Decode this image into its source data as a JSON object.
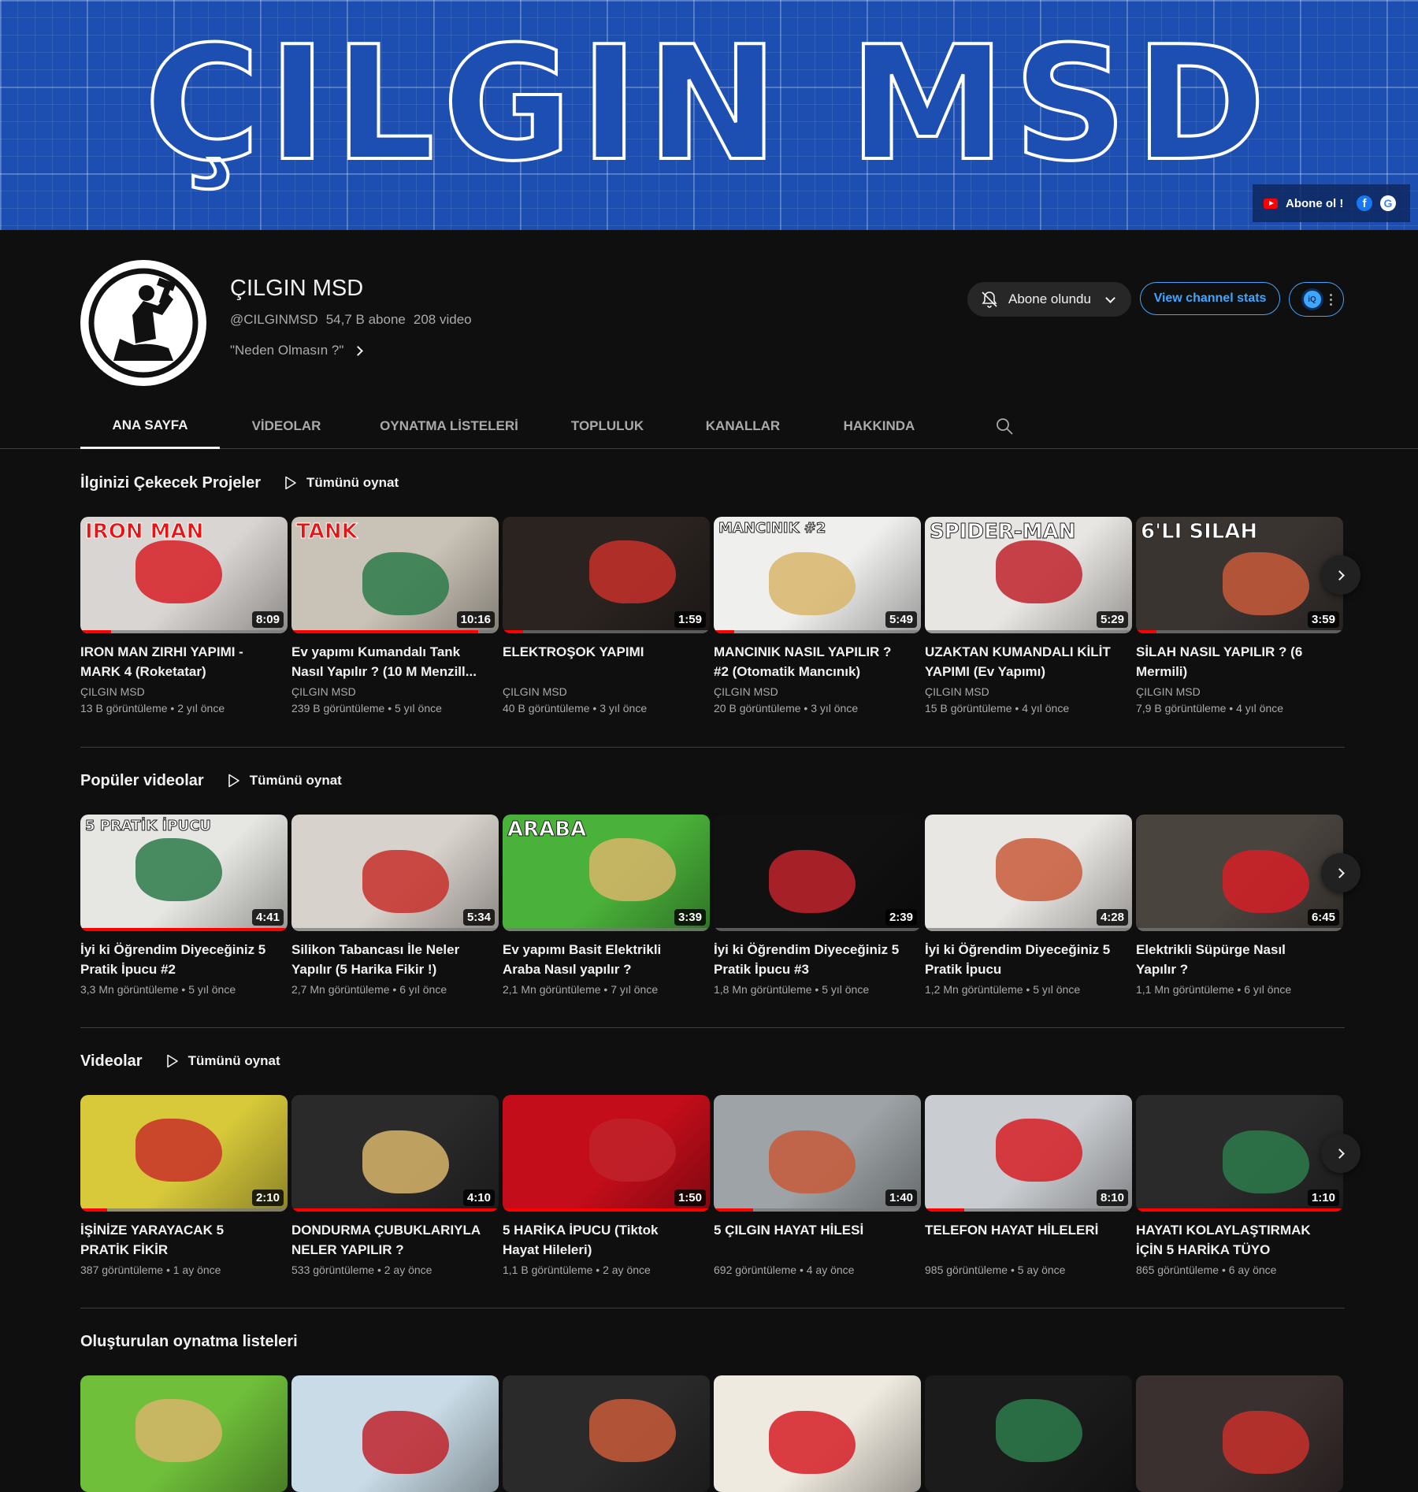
{
  "banner": {
    "title": "ÇILGIN MSD",
    "links": [
      {
        "label": "Abone ol !",
        "icon": "youtube-icon"
      },
      {
        "label": "",
        "icon": "facebook-icon"
      },
      {
        "label": "",
        "icon": "google-icon"
      }
    ]
  },
  "channel": {
    "name": "ÇILGIN MSD",
    "handle": "@CILGINMSD",
    "subscribers": "54,7 B abone",
    "video_count": "208 video",
    "description": "\"Neden Olmasın ?\"",
    "subscribed_label": "Abone olundu",
    "stats_label": "View channel stats",
    "ext_badge": "iQ"
  },
  "tabs": [
    {
      "label": "ANA SAYFA",
      "active": true
    },
    {
      "label": "VİDEOLAR",
      "active": false
    },
    {
      "label": "OYNATMA LİSTELERİ",
      "active": false
    },
    {
      "label": "TOPLULUK",
      "active": false
    },
    {
      "label": "KANALLAR",
      "active": false
    },
    {
      "label": "HAKKINDA",
      "active": false
    }
  ],
  "shelves": [
    {
      "title": "İlginizi Çekecek Projeler",
      "play_all": "Tümünü oynat",
      "videos": [
        {
          "title": "IRON MAN ZIRHI YAPIMI - MARK 4 (Roketatar)",
          "channel": "ÇILGIN MSD",
          "meta": "13 B görüntüleme • 2 yıl önce",
          "duration": "8:09",
          "tag": "IRON MAN",
          "progress": 0.15
        },
        {
          "title": "Ev yapımı Kumandalı Tank Nasıl Yapılır ? (10 M Menzill...",
          "channel": "ÇILGIN MSD",
          "meta": "239 B görüntüleme • 5 yıl önce",
          "duration": "10:16",
          "tag": "TANK",
          "progress": 0.9
        },
        {
          "title": "ELEKTROŞOK YAPIMI",
          "channel": "ÇILGIN MSD",
          "meta": "40 B görüntüleme • 3 yıl önce",
          "duration": "1:59",
          "tag": "",
          "progress": 0.1
        },
        {
          "title": "MANCINIK NASIL YAPILIR ? #2 (Otomatik Mancınık)",
          "channel": "ÇILGIN MSD",
          "meta": "20 B görüntüleme • 3 yıl önce",
          "duration": "5:49",
          "tag": "MANCINIK #2",
          "progress": 0.1
        },
        {
          "title": "UZAKTAN KUMANDALI KİLİT YAPIMI (Ev Yapımı)",
          "channel": "ÇILGIN MSD",
          "meta": "15 B görüntüleme • 4 yıl önce",
          "duration": "5:29",
          "tag": "SPIDER-MAN",
          "progress": 0.0
        },
        {
          "title": "SİLAH NASIL YAPILIR ? (6 Mermili)",
          "channel": "ÇILGIN MSD",
          "meta": "7,9 B görüntüleme • 4 yıl önce",
          "duration": "3:59",
          "tag": "6'LI SILAH",
          "progress": 0.1
        }
      ]
    },
    {
      "title": "Popüler videolar",
      "play_all": "Tümünü oynat",
      "videos": [
        {
          "title": "İyi ki Öğrendim Diyeceğiniz 5 Pratik İpucu #2",
          "channel": "",
          "meta": "3,3 Mn görüntüleme • 5 yıl önce",
          "duration": "4:41",
          "tag": "5 PRATİK İPUCU",
          "progress": 1.0
        },
        {
          "title": "Silikon Tabancası İle Neler Yapılır (5 Harika Fikir !)",
          "channel": "",
          "meta": "2,7 Mn görüntüleme • 6 yıl önce",
          "duration": "5:34",
          "tag": "",
          "progress": 0.0
        },
        {
          "title": "Ev yapımı Basit Elektrikli Araba Nasıl yapılır ?",
          "channel": "",
          "meta": "2,1 Mn görüntüleme • 7 yıl önce",
          "duration": "3:39",
          "tag": "ARABA",
          "progress": 0.0
        },
        {
          "title": "İyi ki Öğrendim Diyeceğiniz 5 Pratik İpucu #3",
          "channel": "",
          "meta": "1,8 Mn görüntüleme • 5 yıl önce",
          "duration": "2:39",
          "tag": "",
          "progress": 0.0
        },
        {
          "title": "İyi ki Öğrendim Diyeceğiniz 5 Pratik İpucu",
          "channel": "",
          "meta": "1,2 Mn görüntüleme • 5 yıl önce",
          "duration": "4:28",
          "tag": "",
          "progress": 0.0
        },
        {
          "title": "Elektrikli Süpürge Nasıl Yapılır ?",
          "channel": "",
          "meta": "1,1 Mn görüntüleme • 6 yıl önce",
          "duration": "6:45",
          "tag": "",
          "progress": 0.0
        }
      ]
    },
    {
      "title": "Videolar",
      "play_all": "Tümünü oynat",
      "videos": [
        {
          "title": "İŞİNİZE YARAYACAK 5 PRATİK FİKİR",
          "channel": "",
          "meta": "387 görüntüleme • 1 ay önce",
          "duration": "2:10",
          "tag": "",
          "progress": 0.13
        },
        {
          "title": "DONDURMA ÇUBUKLARIYLA NELER YAPILIR ?",
          "channel": "",
          "meta": "533 görüntüleme • 2 ay önce",
          "duration": "4:10",
          "tag": "",
          "progress": 1.0
        },
        {
          "title": "5 HARİKA İPUCU (Tiktok Hayat Hileleri)",
          "channel": "",
          "meta": "1,1 B görüntüleme • 2 ay önce",
          "duration": "1:50",
          "tag": "",
          "progress": 1.0
        },
        {
          "title": "5 ÇILGIN HAYAT HİLESİ",
          "channel": "",
          "meta": "692 görüntüleme • 4 ay önce",
          "duration": "1:40",
          "tag": "",
          "progress": 0.19
        },
        {
          "title": "TELEFON HAYAT HİLELERİ",
          "channel": "",
          "meta": "985 görüntüleme • 5 ay önce",
          "duration": "8:10",
          "tag": "",
          "progress": 0.19
        },
        {
          "title": "HAYATI KOLAYLAŞTIRMAK İÇİN 5 HARİKA TÜYO",
          "channel": "",
          "meta": "865 görüntüleme • 6 ay önce",
          "duration": "1:10",
          "tag": "",
          "progress": 1.0
        }
      ]
    },
    {
      "title": "Oluşturulan oynatma listeleri",
      "play_all": "",
      "videos": []
    }
  ],
  "thumbnail_colors": [
    [
      "#d9d5d2",
      "#c9c2b6",
      "#2a2320",
      "#efefee",
      "#e8e6e2",
      "#3a3431"
    ],
    [
      "#e6e6e2",
      "#d8d2cc",
      "#4ab23a",
      "#111111",
      "#e9e7e3",
      "#4a443f"
    ],
    [
      "#d7c93a",
      "#2a2a2a",
      "#c40d1a",
      "#9da3a6",
      "#c9ccd0",
      "#2a2a2a"
    ],
    [
      "#6fbf3a",
      "#c8dbe6",
      "#2a2a2a",
      "#efeadf",
      "#1b1b1b",
      "#3b3030"
    ]
  ],
  "accent": "#3ea6ff",
  "progress_color": "#ff0000"
}
